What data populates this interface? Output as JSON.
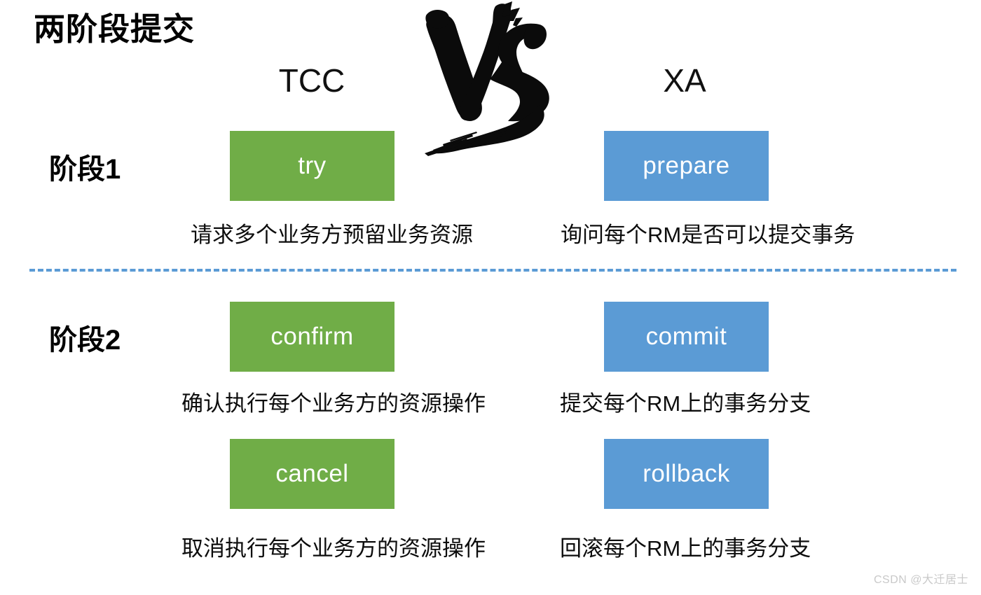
{
  "slide": {
    "title": "两阶段提交",
    "watermark": "CSDN @大迁居士",
    "vs_label": "VS"
  },
  "columns": [
    {
      "key": "tcc",
      "header": "TCC",
      "accent": "#70AD47"
    },
    {
      "key": "xa",
      "header": "XA",
      "accent": "#5B9BD5"
    }
  ],
  "phases": [
    {
      "label": "阶段1",
      "steps": [
        {
          "column": "tcc",
          "box": "try",
          "caption": "请求多个业务方预留业务资源"
        },
        {
          "column": "xa",
          "box": "prepare",
          "caption": "询问每个RM是否可以提交事务"
        }
      ]
    },
    {
      "label": "阶段2",
      "steps": [
        {
          "column": "tcc",
          "box": "confirm",
          "caption": "确认执行每个业务方的资源操作"
        },
        {
          "column": "xa",
          "box": "commit",
          "caption": "提交每个RM上的事务分支"
        },
        {
          "column": "tcc",
          "box": "cancel",
          "caption": "取消执行每个业务方的资源操作"
        },
        {
          "column": "xa",
          "box": "rollback",
          "caption": "回滚每个RM上的事务分支"
        }
      ]
    }
  ],
  "boxes": {
    "try": "try",
    "prepare": "prepare",
    "confirm": "confirm",
    "commit": "commit",
    "cancel": "cancel",
    "rollback": "rollback"
  },
  "captions": {
    "try": "请求多个业务方预留业务资源",
    "prepare": "询问每个RM是否可以提交事务",
    "confirm": "确认执行每个业务方的资源操作",
    "commit": "提交每个RM上的事务分支",
    "cancel": "取消执行每个业务方的资源操作",
    "rollback": "回滚每个RM上的事务分支"
  },
  "colors": {
    "green": "#70AD47",
    "blue": "#5B9BD5",
    "divider": "#5B9BD5",
    "text": "#0d0d0d",
    "watermark": "#c9c9c9"
  }
}
